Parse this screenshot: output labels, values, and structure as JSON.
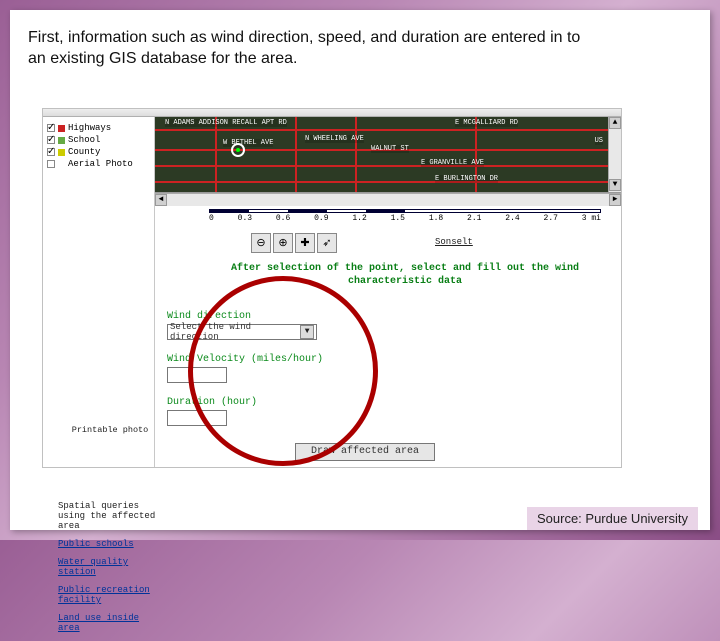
{
  "caption": "First, information such as wind direction, speed, and duration are entered in to an existing GIS database for the area.",
  "source_label": "Source: Purdue University",
  "layers": [
    {
      "label": "Highways",
      "color": "#c22",
      "checked": true
    },
    {
      "label": "School",
      "color": "#6a4",
      "checked": true
    },
    {
      "label": "County",
      "color": "#cc0",
      "checked": true
    },
    {
      "label": "Aerial Photo",
      "color": "",
      "checked": false
    }
  ],
  "roads": {
    "labels": [
      "N ADAMS ADDISON RECALL APT RD",
      "W BETHEL AVE",
      "N WHEELING AVE",
      "WALNUT ST",
      "E GRANVILLE AVE",
      "E MCGALLIARD RD",
      "E BURLINGTON DR",
      "US"
    ]
  },
  "scale": {
    "ticks": [
      "0",
      "0.3",
      "0.6",
      "0.9",
      "1.2",
      "1.5",
      "1.8",
      "2.1",
      "2.4",
      "2.7",
      "3 mi"
    ]
  },
  "toolbar": {
    "zoom_out_title": "Zoom out",
    "zoom_in_title": "Zoom in",
    "pan_title": "Pan",
    "identify_title": "Identify",
    "sonselt": "Sonselt"
  },
  "instruction": "After selection of the point, select and fill out the wind characteristic data",
  "left_panel": {
    "print_photo": "Printable photo",
    "spatial_queries": "Spatial queries using the affected area",
    "links": [
      "Public schools",
      "Water quality station",
      "Public recreation facility",
      "Land use inside area"
    ]
  },
  "form": {
    "dir_label": "Wind direction",
    "dir_placeholder": "Select the wind direction",
    "vel_label": "Wind Velocity (miles/hour)",
    "dur_label": "Duration (hour)",
    "draw_button": "Draw affected area"
  }
}
